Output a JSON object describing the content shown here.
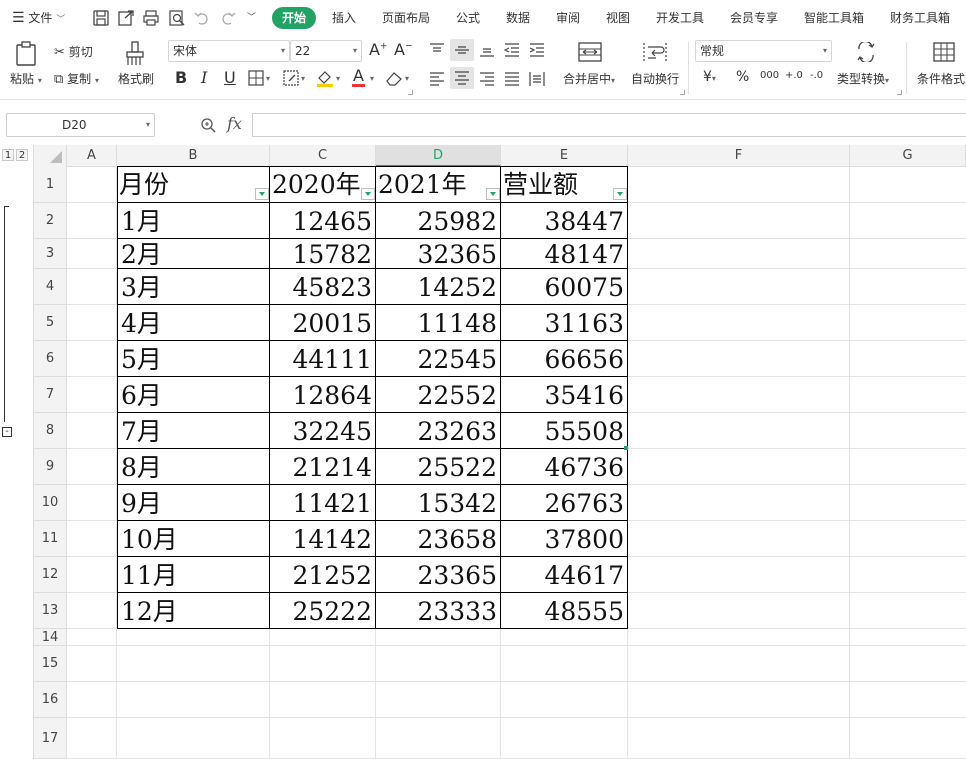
{
  "menu": {
    "file_label": "文件",
    "tabs": [
      "开始",
      "插入",
      "页面布局",
      "公式",
      "数据",
      "审阅",
      "视图",
      "开发工具",
      "会员专享",
      "智能工具箱",
      "财务工具箱"
    ]
  },
  "ribbon": {
    "paste_label": "粘贴",
    "cut_label": "剪切",
    "copy_label": "复制",
    "format_painter_label": "格式刷",
    "font_name": "宋体",
    "font_size": "22",
    "merge_center_label": "合并居中",
    "wrap_text_label": "自动换行",
    "number_format": "常规",
    "type_convert_label": "类型转换",
    "conditional_format_label": "条件格式",
    "bold": "B",
    "italic": "I",
    "underline": "U",
    "font_color_letter": "A",
    "currency_symbol": "¥",
    "percent_symbol": "%",
    "thousands_symbol": "000",
    "decimal_increase": "+.0",
    "decimal_decrease": "-.0",
    "font_size_up": "A",
    "font_size_down": "A"
  },
  "formula_bar": {
    "cell_ref": "D20",
    "fx_label": "fx",
    "formula": ""
  },
  "sheet": {
    "outline_levels": [
      "1",
      "2"
    ],
    "columns": [
      "A",
      "B",
      "C",
      "D",
      "E",
      "F",
      "G"
    ],
    "selected_column": "D",
    "rows": [
      "1",
      "2",
      "3",
      "4",
      "5",
      "6",
      "7",
      "8",
      "9",
      "10",
      "11",
      "12",
      "13",
      "14",
      "15",
      "16",
      "17"
    ],
    "table": {
      "headers": [
        "月份",
        "2020年",
        "2021年",
        "营业额"
      ],
      "data": [
        [
          "1月",
          "12465",
          "25982",
          "38447"
        ],
        [
          "2月",
          "15782",
          "32365",
          "48147"
        ],
        [
          "3月",
          "45823",
          "14252",
          "60075"
        ],
        [
          "4月",
          "20015",
          "11148",
          "31163"
        ],
        [
          "5月",
          "44111",
          "22545",
          "66656"
        ],
        [
          "6月",
          "12864",
          "22552",
          "35416"
        ],
        [
          "7月",
          "32245",
          "23263",
          "55508"
        ],
        [
          "8月",
          "21214",
          "25522",
          "46736"
        ],
        [
          "9月",
          "11421",
          "15342",
          "26763"
        ],
        [
          "10月",
          "14142",
          "23658",
          "37800"
        ],
        [
          "11月",
          "21252",
          "23365",
          "44617"
        ],
        [
          "12月",
          "25222",
          "23333",
          "48555"
        ]
      ]
    }
  },
  "colors": {
    "accent_green": "#21a366",
    "header_gray": "#f3f3f3"
  }
}
